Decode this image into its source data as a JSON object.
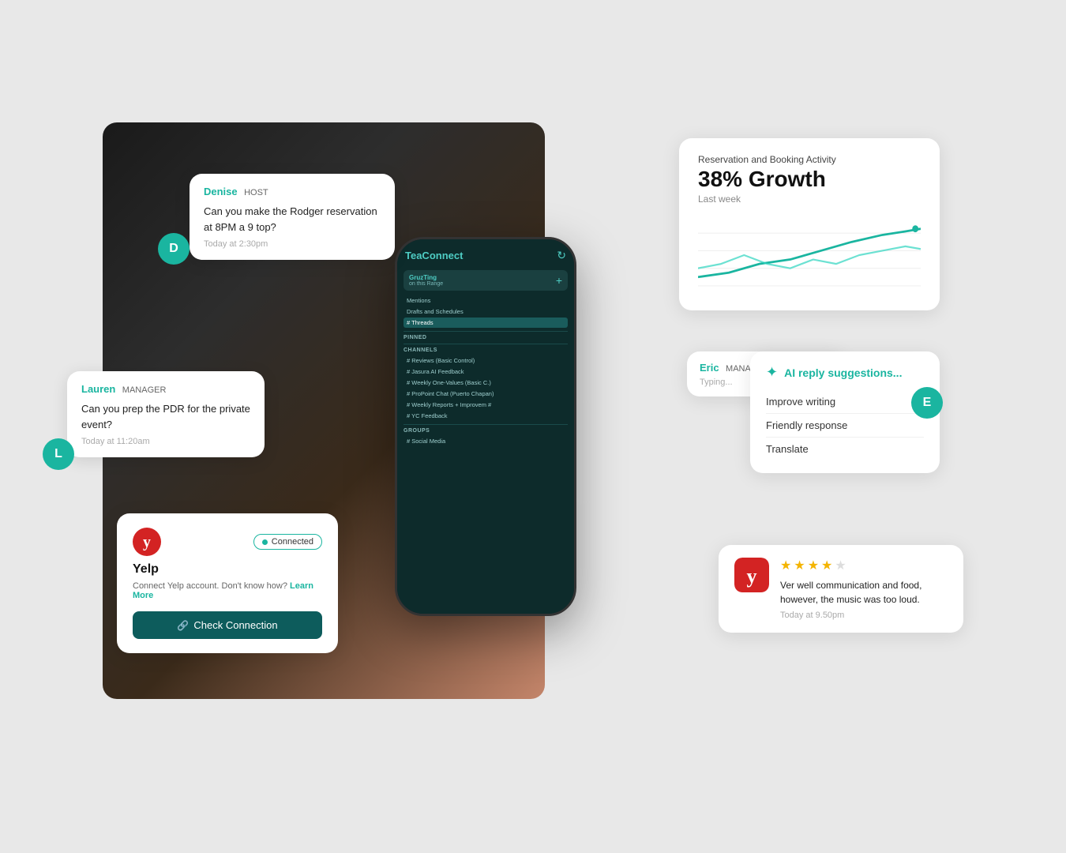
{
  "bg": {
    "alt": "Person holding phone"
  },
  "phone": {
    "app_name": "TeaConnect",
    "channels": {
      "pinned_label": "PINNED",
      "channels_label": "CHANNELS",
      "groups_label": "GROUPS",
      "items": [
        {
          "name": "Mentions",
          "active": false
        },
        {
          "name": "Drafts and Schedules",
          "active": false
        },
        {
          "name": "# Threads",
          "active": true
        },
        {
          "name": "# Reviews (Basic Control)",
          "active": false
        },
        {
          "name": "# Jasura AI Feedback",
          "active": false
        },
        {
          "name": "# Weekly One-Values (Basic C.)",
          "active": false
        },
        {
          "name": "# ProPoint Chat (Puerto Chapan)",
          "active": false
        },
        {
          "name": "# Weekly Reports + Improvem #",
          "active": false
        },
        {
          "name": "# YC Feedback",
          "active": false
        },
        {
          "name": "# Social Media",
          "active": false
        }
      ]
    }
  },
  "bubble_denise": {
    "name": "Denise",
    "role": "HOST",
    "avatar_initial": "D",
    "message": "Can you make the Rodger reservation at 8PM a 9 top?",
    "time": "Today at 2:30pm"
  },
  "bubble_lauren": {
    "name": "Lauren",
    "role": "MANAGER",
    "avatar_initial": "L",
    "message": "Can you prep the PDR for the private event?",
    "time": "Today at 11:20am"
  },
  "yelp_card": {
    "title": "Yelp",
    "description": "Connect Yelp account. Don't know how?",
    "learn_more": "Learn More",
    "connected_label": "Connected",
    "button_label": "Check Connection",
    "logo_alt": "Yelp logo"
  },
  "analytics_card": {
    "subtitle": "Reservation and Booking Activity",
    "growth": "38% Growth",
    "period": "Last week"
  },
  "ai_card": {
    "label": "AI reply suggestions...",
    "suggestions": [
      {
        "text": "Improve writing"
      },
      {
        "text": "Friendly response"
      },
      {
        "text": "Translate"
      }
    ]
  },
  "eric_bubble": {
    "name": "Eric",
    "role": "MANAGER",
    "avatar_initial": "E",
    "typing": "Typing..."
  },
  "review_card": {
    "stars": 4,
    "total_stars": 5,
    "text": "Ver well communication and food, however, the music was too loud.",
    "time": "Today at 9.50pm"
  }
}
